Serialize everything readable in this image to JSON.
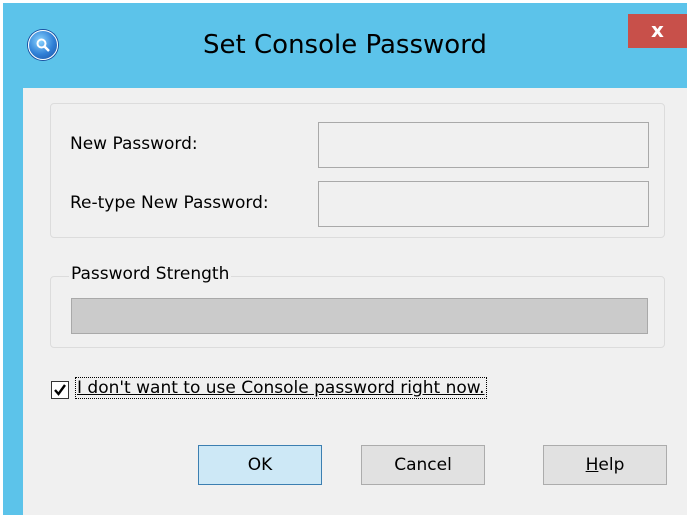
{
  "window": {
    "title": "Set Console Password",
    "close_glyph": "x",
    "app_icon": "search-globe-icon"
  },
  "credentials": {
    "new_password_label": "New Password:",
    "new_password_value": "",
    "retype_password_label": "Re-type New Password:",
    "retype_password_value": ""
  },
  "strength": {
    "group_label": "Password Strength",
    "level": 0
  },
  "options": {
    "skip_password_label": "I don't want to use Console password right now.",
    "skip_password_checked": true
  },
  "buttons": {
    "ok_label": "OK",
    "cancel_label": "Cancel",
    "help_label": "Help",
    "help_accel": "H",
    "help_rest": "elp"
  },
  "colors": {
    "titlebar": "#5cc3ea",
    "close_button": "#c8504a",
    "dialog_background": "#f0f0f0",
    "strength_bar": "#cbcbcb",
    "default_button": "#cde8f6"
  }
}
